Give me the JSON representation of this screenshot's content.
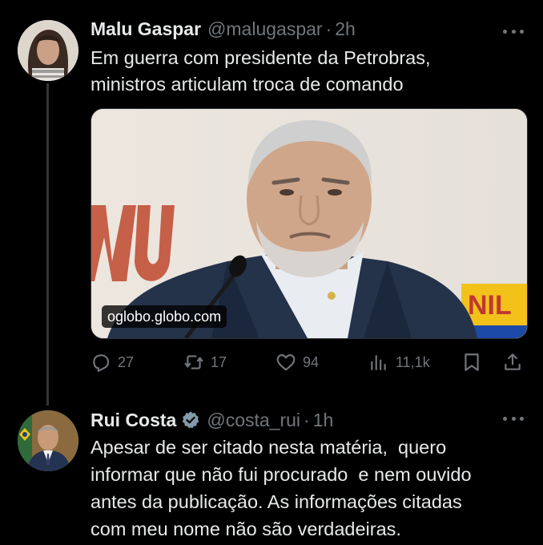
{
  "tweets": [
    {
      "display_name": "Malu Gaspar",
      "handle": "@malugaspar",
      "separator": "·",
      "time": "2h",
      "text_lines": [
        "Em guerra com presidente da Petrobras,",
        "ministros articulam troca de comando"
      ],
      "link_card": {
        "domain": "oglobo.globo.com"
      },
      "actions": {
        "reply": {
          "icon": "reply-icon",
          "count": "27"
        },
        "retweet": {
          "icon": "retweet-icon",
          "count": "17"
        },
        "like": {
          "icon": "heart-icon",
          "count": "94"
        },
        "views": {
          "icon": "bar-chart-icon",
          "count": "11,1k"
        },
        "bookmark": {
          "icon": "bookmark-icon"
        },
        "share": {
          "icon": "share-icon"
        }
      }
    },
    {
      "display_name": "Rui Costa",
      "verified": true,
      "handle": "@costa_rui",
      "separator": "·",
      "time": "1h",
      "text_lines": [
        "Apesar de ser citado nesta matéria,  quero",
        "informar que não fui procurado  e nem ouvido",
        "antes da publicação. As informações citadas",
        "com meu nome não são verdadeiras."
      ]
    }
  ],
  "colors": {
    "background": "#000000",
    "text_primary": "#e7e9ea",
    "text_secondary": "#71767b",
    "verified_badge": "#829aab",
    "thread_line": "#333639"
  }
}
